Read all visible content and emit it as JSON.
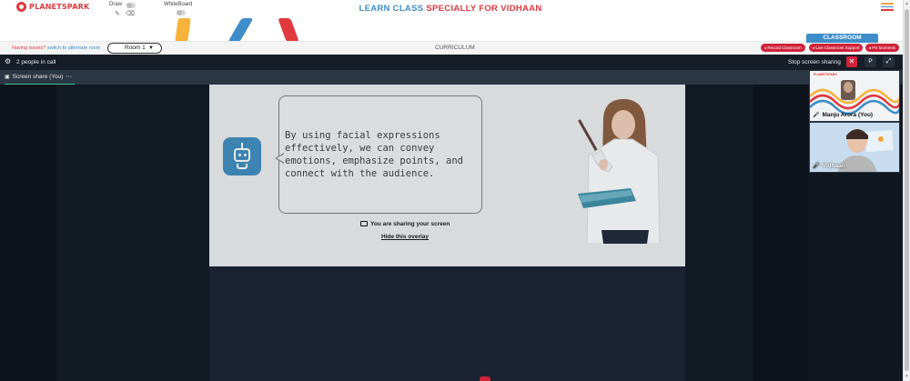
{
  "brand": {
    "logo_text": "PLANETSPARK"
  },
  "tools": {
    "draw_label": "Draw",
    "whiteboard_label": "WhiteBoard"
  },
  "header": {
    "title_part1": "LEARN CLASS",
    "title_part2": "SPECIALLY FOR VIDHAAN"
  },
  "strip": {
    "issues_text": "Having issues?",
    "issues_link": "switch to alternate room",
    "room_value": "Room 1",
    "curriculum_label": "CURRICULUM",
    "classroom_tab": "CLASSROOM",
    "record_label": "Record Classroom",
    "support_label": "Live Classroom Support",
    "moments_label": "PS Moments"
  },
  "meeting": {
    "people_count_text": "2 people in call",
    "stop_share_label": "Stop screen sharing",
    "p_label": "P",
    "share_tab_label": "Screen share (You)",
    "share_tab_more": "⋯"
  },
  "slide": {
    "bubble_text": "By using facial expressions effectively, we can convey emotions, emphasize points, and connect with the audience."
  },
  "overlay": {
    "sharing_text": "You are sharing your screen",
    "hide_link": "Hide this overlay"
  },
  "participants": [
    {
      "name": "Manju Arora (You)",
      "brand": "PLANETSPARK"
    },
    {
      "name": "Vidhaan"
    }
  ],
  "colors": {
    "brand_red": "#e0393e",
    "brand_blue": "#3d8ec9",
    "alert_red": "#d0233a",
    "meet_dark": "#10161f",
    "tab_active": "#3dc18a"
  }
}
